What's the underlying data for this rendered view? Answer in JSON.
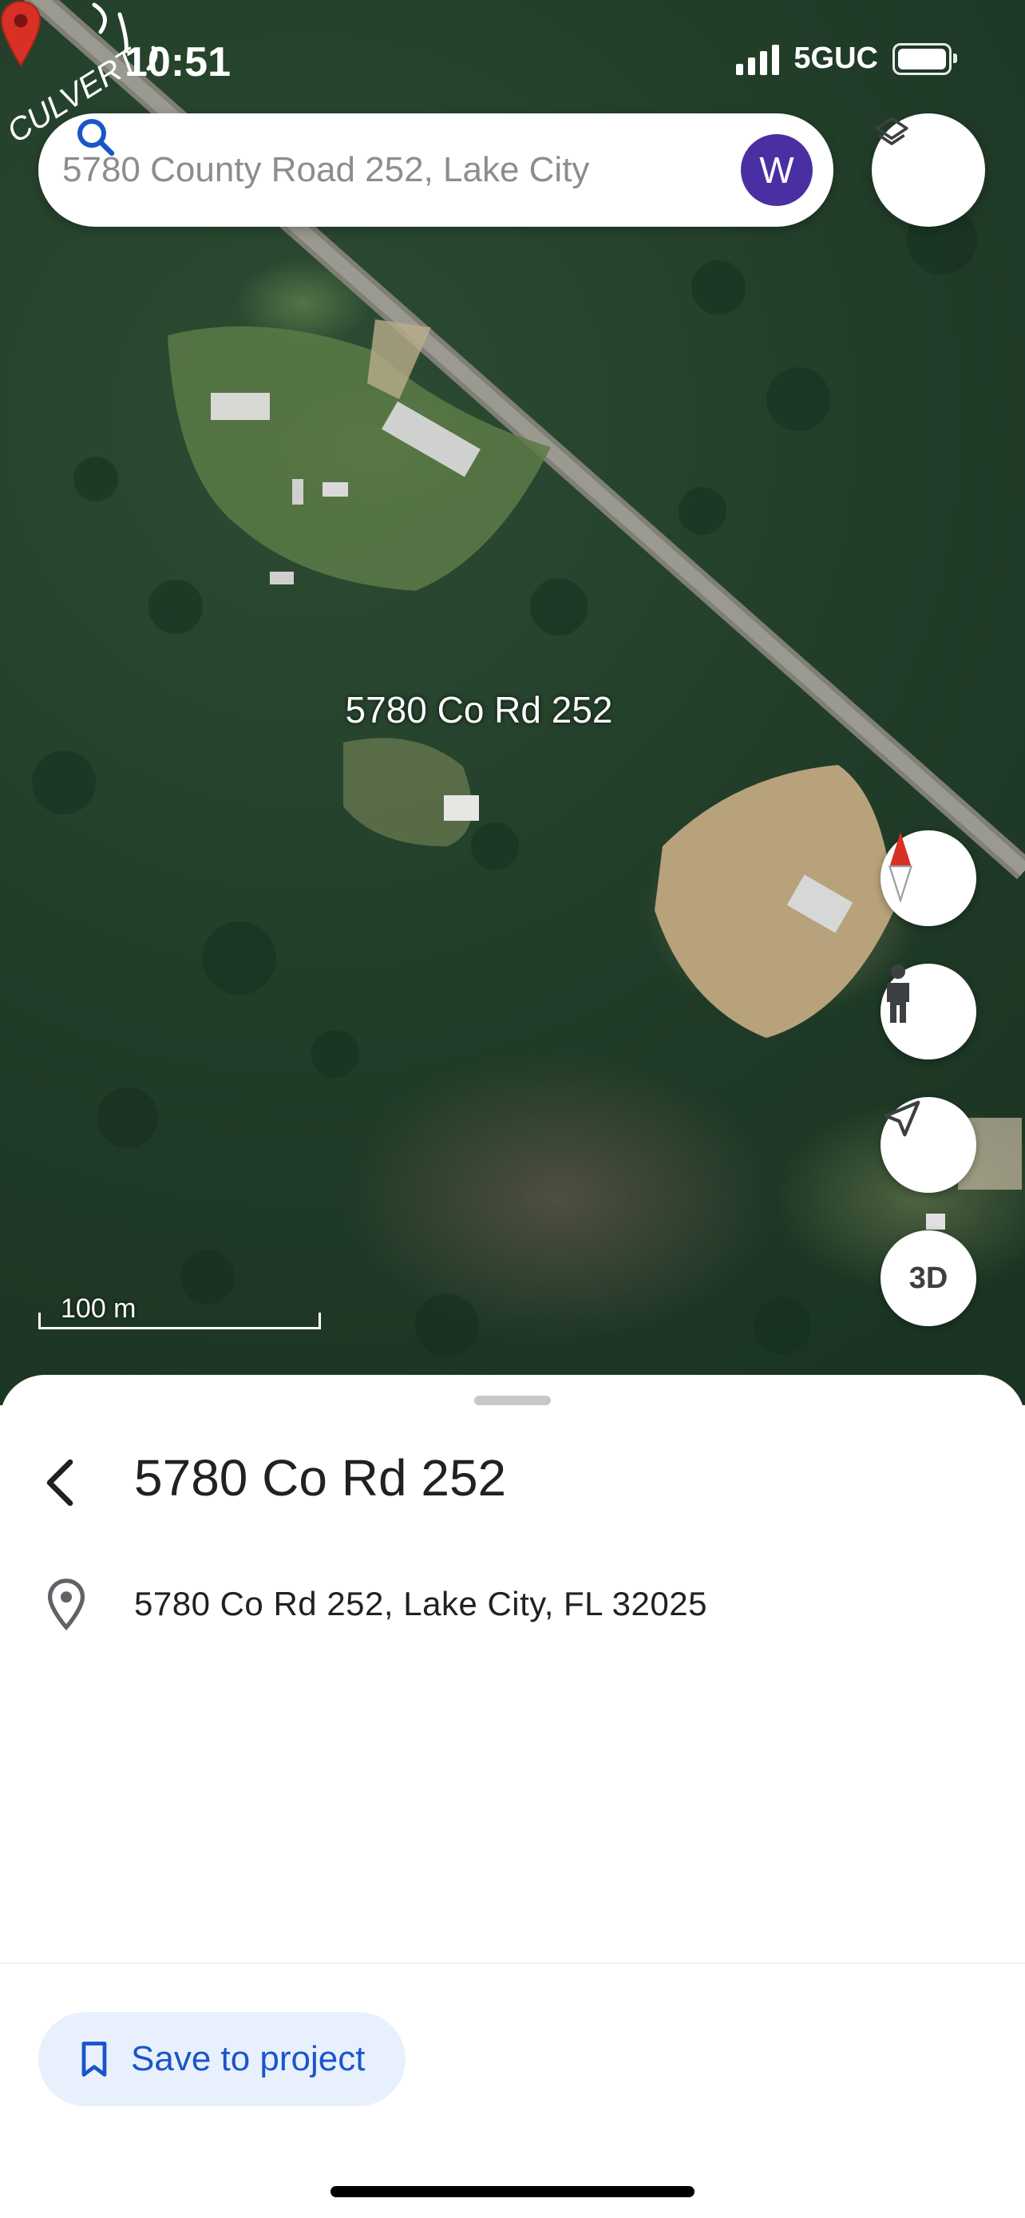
{
  "status_bar": {
    "time": "10:51",
    "network": "5GUC"
  },
  "search": {
    "placeholder": "5780 County Road 252, Lake City",
    "avatar_letter": "W",
    "icon": "search-icon"
  },
  "map": {
    "pin_label": "5780 Co Rd 252",
    "annotation": "CULVERT",
    "scale_label": "100 m",
    "three_d_label": "3D",
    "icons": [
      "layers-icon",
      "compass-icon",
      "pegman-icon",
      "navigation-arrow-icon"
    ]
  },
  "sheet": {
    "title": "5780 Co Rd 252",
    "address": "5780 Co Rd 252, Lake City, FL 32025",
    "save_label": "Save to project"
  },
  "colors": {
    "accent": "#1a56c8",
    "avatar": "#4a2fa3",
    "pin": "#d93025",
    "save_bg": "#e8f0fe"
  }
}
